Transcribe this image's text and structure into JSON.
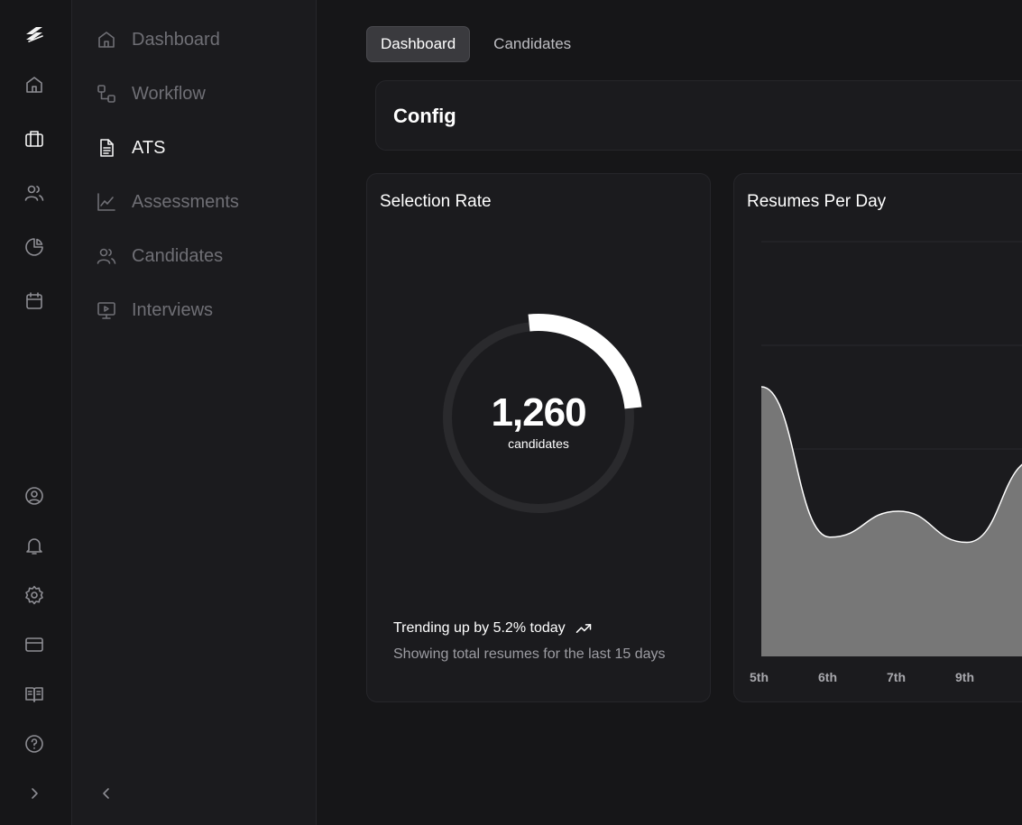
{
  "rail": {
    "top_icons": [
      "logo-icon",
      "home-icon",
      "briefcase-icon",
      "users-icon",
      "pie-chart-icon",
      "calendar-icon"
    ],
    "bottom_icons": [
      "user-circle-icon",
      "bell-icon",
      "settings-icon",
      "credit-card-icon",
      "book-icon",
      "help-icon",
      "chevron-right-icon"
    ]
  },
  "sidebar": {
    "items": [
      {
        "label": "Dashboard",
        "icon": "home-icon"
      },
      {
        "label": "Workflow",
        "icon": "workflow-icon"
      },
      {
        "label": "ATS",
        "icon": "file-text-icon",
        "active": true
      },
      {
        "label": "Assessments",
        "icon": "line-chart-icon"
      },
      {
        "label": "Candidates",
        "icon": "users-icon"
      },
      {
        "label": "Interviews",
        "icon": "presentation-icon"
      }
    ]
  },
  "tabs": [
    {
      "label": "Dashboard",
      "active": true
    },
    {
      "label": "Candidates",
      "active": false
    }
  ],
  "config": {
    "title": "Config"
  },
  "selection_rate": {
    "title": "Selection Rate",
    "value": "1,260",
    "value_label": "candidates",
    "trend": "Trending up by 5.2% today",
    "subtitle": "Showing total resumes for the last 15 days"
  },
  "resumes_per_day": {
    "title": "Resumes Per Day"
  },
  "chart_data": [
    {
      "type": "pie",
      "title": "Selection Rate",
      "center_value": 1260,
      "center_label": "candidates",
      "filled_fraction": 0.25,
      "colors": {
        "filled": "#ffffff",
        "track": "#2a2a2d"
      }
    },
    {
      "type": "area",
      "title": "Resumes Per Day",
      "categories": [
        "5th",
        "6th",
        "7th",
        "9th"
      ],
      "values": [
        260,
        115,
        140,
        110
      ],
      "trailing_value": 190,
      "ylim": [
        0,
        400
      ],
      "grid": true,
      "colors": {
        "fill": "#777777",
        "line": "#ffffff"
      }
    }
  ]
}
